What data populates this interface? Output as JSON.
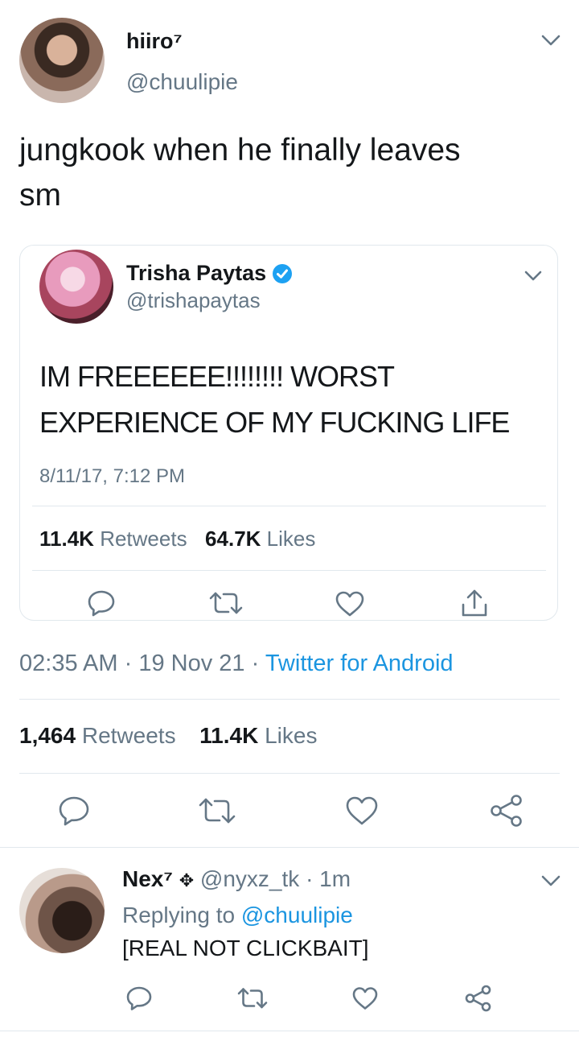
{
  "tweet": {
    "author_name": "hiiro⁷",
    "author_handle": "@chuulipie",
    "text_line1": "jungkook when he finally leaves",
    "text_line2": "sm",
    "time": "02:35 AM",
    "sep1": "·",
    "date": "19 Nov 21",
    "sep2": "·",
    "client": "Twitter for Android",
    "retweets_count": "1,464",
    "retweets_label": "Retweets",
    "likes_count": "11.4K",
    "likes_label": "Likes"
  },
  "quoted": {
    "author_name": "Trisha Paytas",
    "author_handle": "@trishapaytas",
    "text_line1": "IM FREEEEEE!!!!!!!! WORST",
    "text_line2": "EXPERIENCE OF MY FUCKING LIFE",
    "timestamp": "8/11/17, 7:12 PM",
    "retweets_count": "11.4K",
    "retweets_label": "Retweets",
    "likes_count": "64.7K",
    "likes_label": "Likes"
  },
  "reply": {
    "author_name": "Nex⁷",
    "author_emoji": "✥",
    "author_handle": "@nyxz_tk",
    "sep": "·",
    "time_ago": "1m",
    "replying_prefix": "Replying to",
    "replying_handle": "@chuulipie",
    "text": "[REAL NOT CLICKBAIT]"
  },
  "colors": {
    "accent": "#1b95e0",
    "secondary_text": "#657786",
    "verified": "#1da1f2",
    "divider": "#e1e8ed"
  }
}
